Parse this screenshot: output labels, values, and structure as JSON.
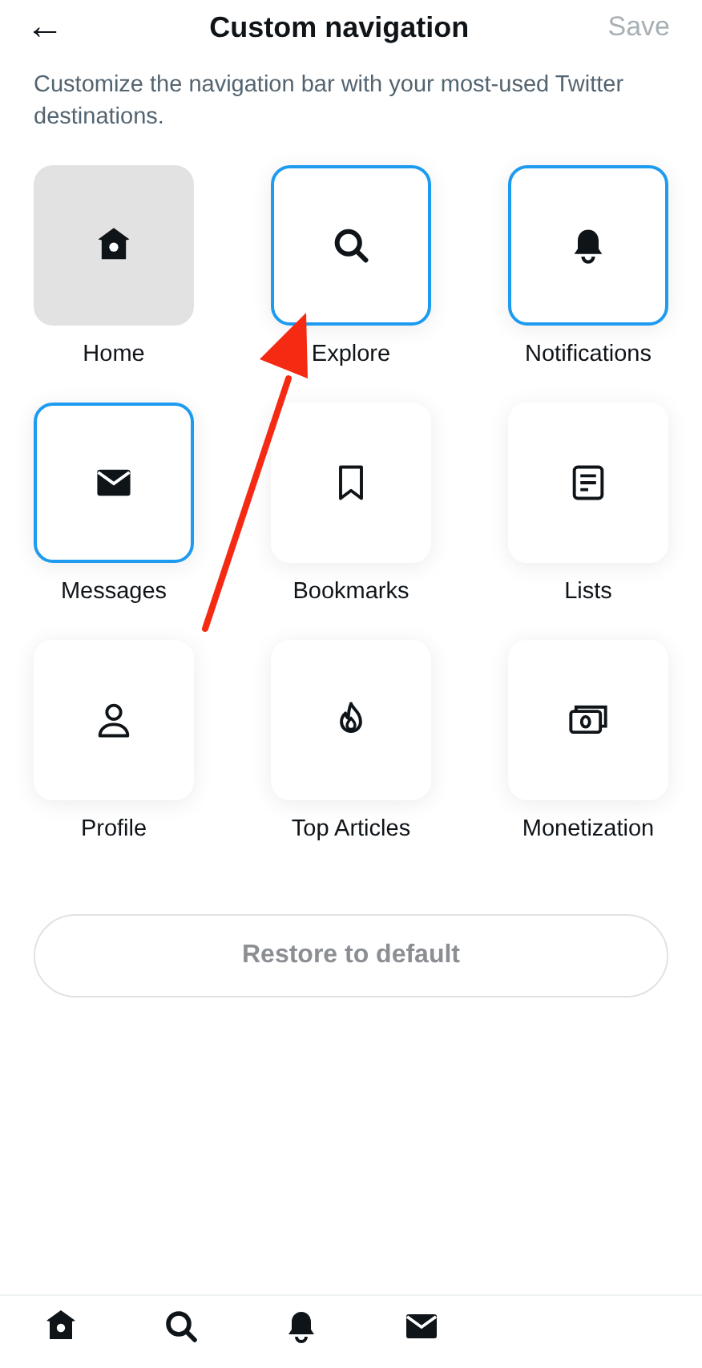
{
  "header": {
    "back": "←",
    "title": "Custom navigation",
    "save": {
      "label": "Save",
      "disabled": true
    }
  },
  "description": "Customize the navigation bar with your most-used Twitter destinations.",
  "destinations": [
    {
      "label": "Home",
      "selected": false,
      "locked": true
    },
    {
      "label": "Explore",
      "selected": true,
      "locked": false
    },
    {
      "label": "Notifications",
      "selected": true,
      "locked": false
    },
    {
      "label": "Messages",
      "selected": true,
      "locked": false
    },
    {
      "label": "Bookmarks",
      "selected": false,
      "locked": false
    },
    {
      "label": "Lists",
      "selected": false,
      "locked": false
    },
    {
      "label": "Profile",
      "selected": false,
      "locked": false
    },
    {
      "label": "Top Articles",
      "selected": false,
      "locked": false
    },
    {
      "label": "Monetization",
      "selected": false,
      "locked": false
    }
  ],
  "restore_button": "Restore to default",
  "annotations": [
    {
      "kind": "arrow"
    }
  ]
}
